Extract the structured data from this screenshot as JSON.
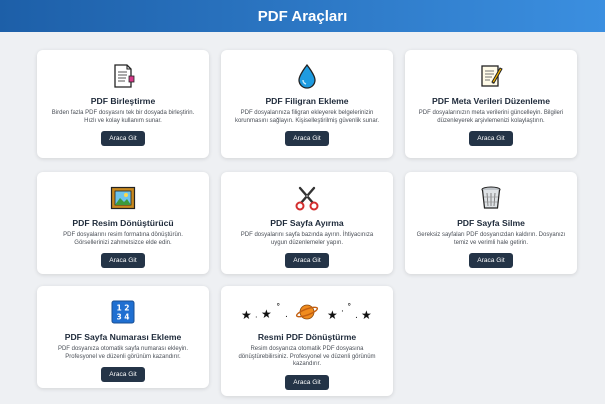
{
  "header": {
    "title": "PDF Araçları"
  },
  "button_label": "Araca Git",
  "cards": [
    {
      "title": "PDF Birleştirme",
      "desc": "Birden fazla PDF dosyasını tek bir dosyada birleştirin. Hızlı ve kolay kullanım sunar.",
      "icon": "document-merge-icon"
    },
    {
      "title": "PDF Filigran Ekleme",
      "desc": "PDF dosyalarınıza filigran ekleyerek belgelerinizin korunmasını sağlayın. Kişiselleştirilmiş güvenlik sunar.",
      "icon": "water-drop-icon"
    },
    {
      "title": "PDF Meta Verileri Düzenleme",
      "desc": "PDF dosyalarınızın meta verilerini güncelleyin. Bilgileri düzenleyerek arşivlemenizi kolaylaştırın.",
      "icon": "memo-edit-icon"
    },
    {
      "title": "PDF Resim Dönüştürücü",
      "desc": "PDF dosyalarını resim formatına dönüştürün. Görsellerinizi zahmetsizce elde edin.",
      "icon": "framed-picture-icon"
    },
    {
      "title": "PDF Sayfa Ayırma",
      "desc": "PDF dosyalarını sayfa bazında ayırın. İhtiyacınıza uygun düzenlemeler yapın.",
      "icon": "scissors-icon"
    },
    {
      "title": "PDF Sayfa Silme",
      "desc": "Gereksiz sayfaları PDF dosyanızdan kaldırın. Dosyanızı temiz ve verimli hale getirin.",
      "icon": "trash-bin-icon"
    },
    {
      "title": "PDF Sayfa Numarası Ekleme",
      "desc": "PDF dosyanıza otomatik sayfa numarası ekleyin. Profesyonel ve düzenli görünüm kazandırır.",
      "icon": "numbers-1234-icon",
      "icon_text": "1 2 3 4"
    },
    {
      "title": "Resmi PDF Dönüştürme",
      "desc": "Resim dosyanıza otomatik PDF dosyasına dönüştürebilirsiniz. Profesyonel ve düzenli görünüm kazandırır.",
      "icon": "milky-way-planet-stars-icon"
    }
  ]
}
